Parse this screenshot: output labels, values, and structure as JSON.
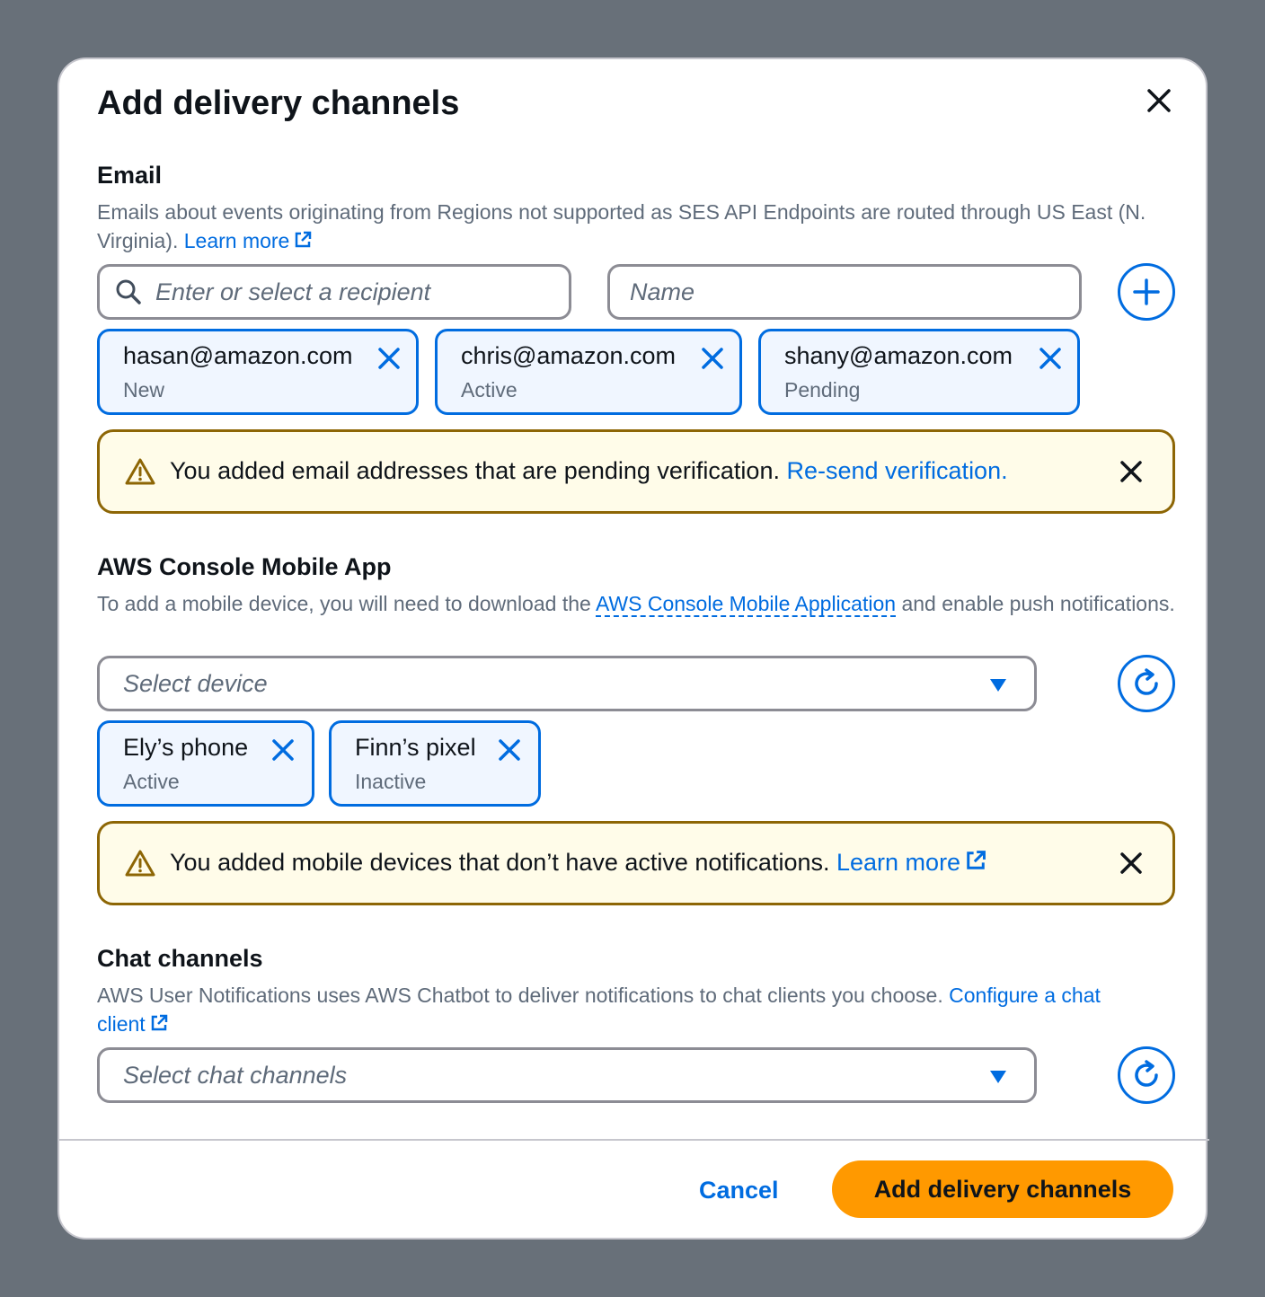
{
  "modal": {
    "title": "Add delivery channels",
    "close_icon": "close-icon"
  },
  "email": {
    "title": "Email",
    "description": "Emails about events originating from Regions not supported as SES API Endpoints are routed through US East (N. Virginia).",
    "learn_more": "Learn more",
    "recipient_placeholder": "Enter or select a recipient",
    "name_placeholder": "Name",
    "add_icon": "plus-circle-icon",
    "tokens": [
      {
        "label": "hasan@amazon.com",
        "status": "New"
      },
      {
        "label": "chris@amazon.com",
        "status": "Active"
      },
      {
        "label": "shany@amazon.com",
        "status": "Pending"
      }
    ],
    "alert": {
      "text": "You added email addresses that are pending verification.",
      "link": "Re-send verification."
    }
  },
  "mobile": {
    "title": "AWS Console Mobile App",
    "description_before": "To add a mobile device, you will need to download the",
    "description_link": "AWS Console Mobile Application",
    "description_after": "and enable push notifications.",
    "select_placeholder": "Select device",
    "refresh_icon": "refresh-icon",
    "tokens": [
      {
        "label": "Ely’s phone",
        "status": "Active"
      },
      {
        "label": "Finn’s pixel",
        "status": "Inactive"
      }
    ],
    "alert": {
      "text": "You added mobile devices that don’t have active notifications.",
      "link": "Learn more"
    }
  },
  "chat": {
    "title": "Chat channels",
    "description": "AWS User Notifications uses AWS Chatbot to deliver notifications to chat clients you choose.",
    "link": "Configure a chat client",
    "select_placeholder": "Select chat channels",
    "refresh_icon": "refresh-icon"
  },
  "footer": {
    "cancel": "Cancel",
    "submit": "Add delivery channels"
  },
  "colors": {
    "accent": "#006ce0",
    "warning_border": "#8d6605",
    "warning_bg": "#fffce9",
    "primary": "#ff9900"
  }
}
